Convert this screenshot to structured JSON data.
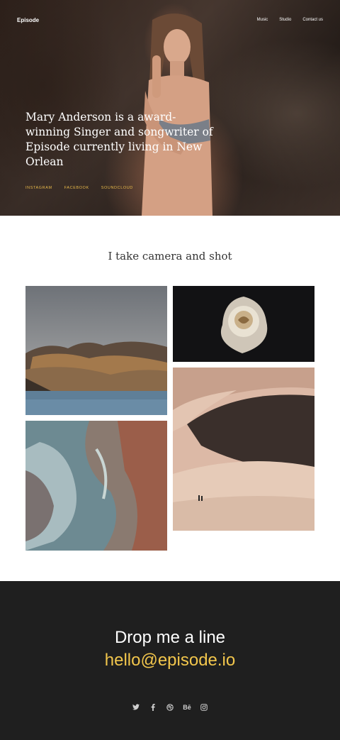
{
  "header": {
    "brand": "Episode",
    "nav": [
      "Music",
      "Studio",
      "Contact us"
    ]
  },
  "hero": {
    "text": "Mary Anderson is a award-winning Singer and songwriter of Episode currently living in New Orlean",
    "social": [
      "INSTAGRAM",
      "FACEBOOK",
      "SOUNDCLOUD"
    ]
  },
  "gallery": {
    "title": "I take camera and shot"
  },
  "contact": {
    "title": "Drop me a line",
    "email": "hello@episode.io",
    "social_icons": [
      "twitter-icon",
      "facebook-icon",
      "dribbble-icon",
      "behance-icon",
      "instagram-icon"
    ],
    "behance_glyph": "Bē"
  },
  "colors": {
    "accent": "#f2c64c",
    "footer_bg": "#1f1f1f",
    "social_link": "#e8b94a"
  }
}
